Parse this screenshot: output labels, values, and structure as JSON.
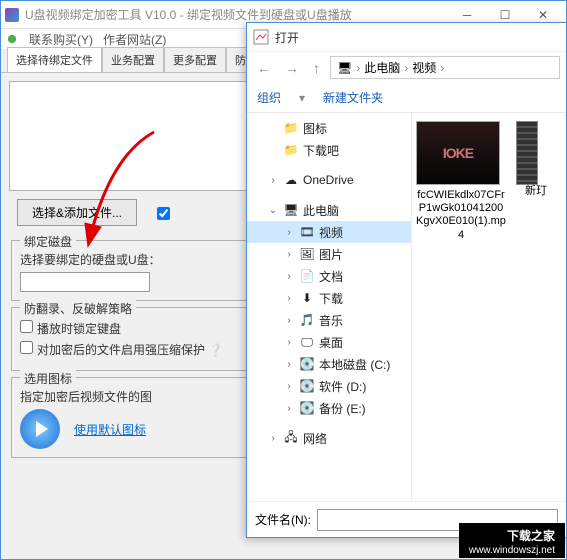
{
  "main": {
    "title": "U盘视频绑定加密工具 V10.0 - 绑定视频文件到硬盘或U盘播放",
    "menu": {
      "buy": "联系购买(Y)",
      "site": "作者网站(Z)"
    },
    "tabs": [
      "选择待绑定文件",
      "业务配置",
      "更多配置",
      "防"
    ],
    "add_button": "选择&添加文件...",
    "group_disk": {
      "legend": "绑定磁盘",
      "label": "选择要绑定的硬盘或U盘："
    },
    "group_anti": {
      "legend": "防翻录、反破解策略",
      "opt1": "播放时锁定键盘",
      "opt2": "对加密后的文件启用强压缩保护"
    },
    "group_icon": {
      "legend": "选用图标",
      "label": "指定加密后视频文件的图",
      "link": "使用默认图标"
    }
  },
  "dialog": {
    "title": "打开",
    "crumb": {
      "root": "此电脑",
      "folder": "视频"
    },
    "toolbar": {
      "organize": "组织",
      "newfolder": "新建文件夹"
    },
    "tree": {
      "icons": "图标",
      "download_folder": "下载吧",
      "onedrive": "OneDrive",
      "thispc": "此电脑",
      "video": "视频",
      "pictures": "图片",
      "documents": "文档",
      "downloads": "下载",
      "music": "音乐",
      "desktop": "桌面",
      "diskC": "本地磁盘 (C:)",
      "diskD": "软件 (D:)",
      "diskE": "备份 (E:)",
      "network": "网络"
    },
    "files": {
      "item1": "fcCWIEkdlx07CFrP1wGk01041200KgvX0E010(1).mp4",
      "item2_partial": "新玎"
    },
    "filename_label": "文件名(N):"
  },
  "watermark": {
    "line1": "下载之家",
    "line2": "www.windowszj.net"
  }
}
